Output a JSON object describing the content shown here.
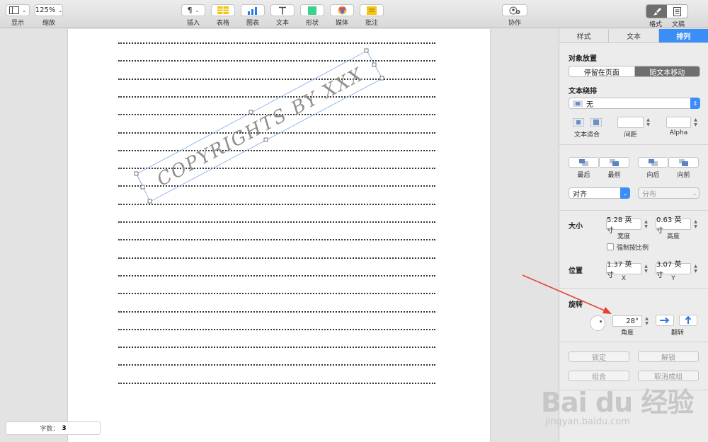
{
  "toolbar": {
    "view_label": "显示",
    "zoom_value": "125%",
    "zoom_label": "缩放",
    "insert_label": "插入",
    "table_label": "表格",
    "chart_label": "图表",
    "text_label": "文本",
    "shape_label": "形状",
    "media_label": "媒体",
    "comment_label": "批注",
    "collab_label": "协作",
    "format_label": "格式",
    "document_label": "文稿"
  },
  "document": {
    "watermark_text": "COPYRIGHTS BY XXX",
    "word_count_label": "字数：",
    "word_count_value": "3"
  },
  "inspector": {
    "tabs": [
      {
        "label": "样式"
      },
      {
        "label": "文本"
      },
      {
        "label": "排列"
      }
    ],
    "object_placement": {
      "title": "对象放置",
      "option_page": "停留在页面",
      "option_text": "随文本移动"
    },
    "text_wrap": {
      "title": "文本绕排",
      "value": "无",
      "fit_label": "文本适合",
      "spacing_label": "间距",
      "alpha_label": "Alpha"
    },
    "layering": {
      "back_label": "最后",
      "front_label": "最前",
      "backward_label": "向后",
      "forward_label": "向前"
    },
    "align": {
      "align_value": "对齐",
      "distribute_value": "分布"
    },
    "size": {
      "title": "大小",
      "width_value": "5.28 英寸",
      "width_label": "宽度",
      "height_value": "0.63 英寸",
      "height_label": "高度",
      "constrain_label": "强制按比例"
    },
    "position": {
      "title": "位置",
      "x_value": "1.37 英寸",
      "x_label": "X",
      "y_value": "3.07 英寸",
      "y_label": "Y"
    },
    "rotate": {
      "title": "旋转",
      "angle_value": "28°",
      "angle_label": "角度",
      "flip_label": "翻转"
    },
    "lock_button": "锁定",
    "unlock_button": "解锁",
    "group_button": "组合",
    "ungroup_button": "取消成组"
  },
  "watermark_brand": {
    "logo_text": "Bai du 经验",
    "url_text": "jingyan.baidu.com"
  },
  "colors": {
    "accent": "#3a8ef6",
    "annotation_arrow": "#e8412f"
  }
}
